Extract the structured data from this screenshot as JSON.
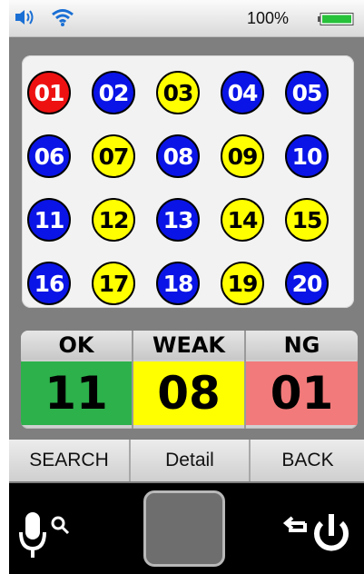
{
  "status_bar": {
    "battery_percent": "100%",
    "battery_level": 1.0,
    "icons": [
      "volume-icon",
      "wifi-icon",
      "battery-icon"
    ]
  },
  "balls": [
    {
      "label": "01",
      "status": "ng",
      "color": "#ee1111"
    },
    {
      "label": "02",
      "status": "ok",
      "color": "#0a14e6"
    },
    {
      "label": "03",
      "status": "weak",
      "color": "#ffff00"
    },
    {
      "label": "04",
      "status": "ok",
      "color": "#0a14e6"
    },
    {
      "label": "05",
      "status": "ok",
      "color": "#0a14e6"
    },
    {
      "label": "06",
      "status": "ok",
      "color": "#0a14e6"
    },
    {
      "label": "07",
      "status": "weak",
      "color": "#ffff00"
    },
    {
      "label": "08",
      "status": "ok",
      "color": "#0a14e6"
    },
    {
      "label": "09",
      "status": "weak",
      "color": "#ffff00"
    },
    {
      "label": "10",
      "status": "ok",
      "color": "#0a14e6"
    },
    {
      "label": "11",
      "status": "ok",
      "color": "#0a14e6"
    },
    {
      "label": "12",
      "status": "weak",
      "color": "#ffff00"
    },
    {
      "label": "13",
      "status": "ok",
      "color": "#0a14e6"
    },
    {
      "label": "14",
      "status": "weak",
      "color": "#ffff00"
    },
    {
      "label": "15",
      "status": "weak",
      "color": "#ffff00"
    },
    {
      "label": "16",
      "status": "ok",
      "color": "#0a14e6"
    },
    {
      "label": "17",
      "status": "weak",
      "color": "#ffff00"
    },
    {
      "label": "18",
      "status": "ok",
      "color": "#0a14e6"
    },
    {
      "label": "19",
      "status": "weak",
      "color": "#ffff00"
    },
    {
      "label": "20",
      "status": "ok",
      "color": "#0a14e6"
    }
  ],
  "summary": {
    "ok": {
      "label": "OK",
      "value": "11",
      "color": "#2db14b"
    },
    "weak": {
      "label": "WEAK",
      "value": "08",
      "color": "#ffff00"
    },
    "ng": {
      "label": "NG",
      "value": "01",
      "color": "#f27a7a"
    }
  },
  "nav": {
    "search_label": "SEARCH",
    "detail_label": "Detail",
    "back_label": "BACK"
  },
  "hardware": {
    "icons": [
      "mic-search-icon",
      "home-button",
      "back-power-icon"
    ]
  }
}
